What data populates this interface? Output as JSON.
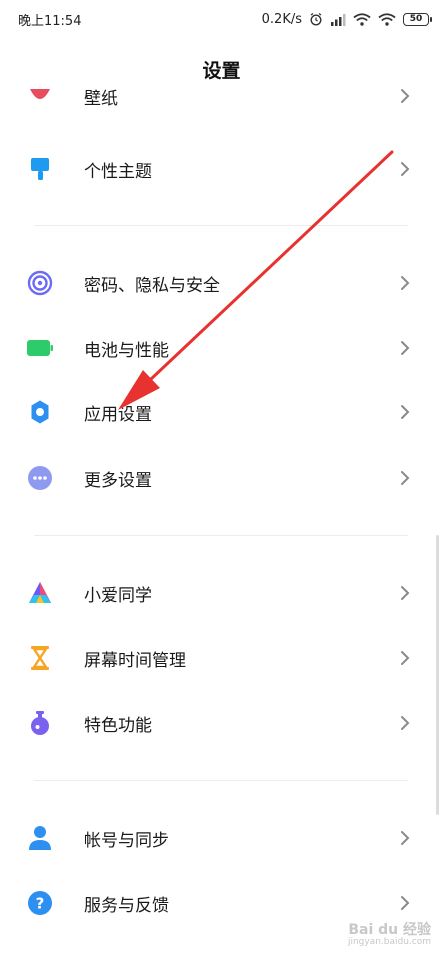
{
  "status_bar": {
    "time": "晚上11:54",
    "net_speed": "0.2K/s",
    "battery": "50"
  },
  "header": {
    "title": "设置"
  },
  "sections": [
    {
      "items": [
        {
          "label": "壁纸",
          "icon": "wallpaper-icon",
          "color": "#e84c5c"
        },
        {
          "label": "个性主题",
          "icon": "theme-brush-icon",
          "color": "#1e9af0"
        }
      ]
    },
    {
      "items": [
        {
          "label": "密码、隐私与安全",
          "icon": "fingerprint-icon",
          "color": "#6b6cf2"
        },
        {
          "label": "电池与性能",
          "icon": "battery-icon",
          "color": "#2dcb6a"
        },
        {
          "label": "应用设置",
          "icon": "gear-icon",
          "color": "#2d8ff0"
        },
        {
          "label": "更多设置",
          "icon": "more-dots-icon",
          "color": "#8e9aef"
        }
      ]
    },
    {
      "items": [
        {
          "label": "小爱同学",
          "icon": "xiaoai-icon",
          "color": "#6e58f2"
        },
        {
          "label": "屏幕时间管理",
          "icon": "hourglass-icon",
          "color": "#f5a623"
        },
        {
          "label": "特色功能",
          "icon": "flask-icon",
          "color": "#7b61f0"
        }
      ]
    },
    {
      "items": [
        {
          "label": "帐号与同步",
          "icon": "account-icon",
          "color": "#2d8ff0"
        },
        {
          "label": "服务与反馈",
          "icon": "help-icon",
          "color": "#2d8ff0"
        }
      ]
    }
  ],
  "watermark": {
    "brand": "Bai du 经验",
    "url": "jingyan.baidu.com"
  },
  "colors": {
    "arrow": "#e8322f",
    "chevron": "#8a8a8a"
  }
}
